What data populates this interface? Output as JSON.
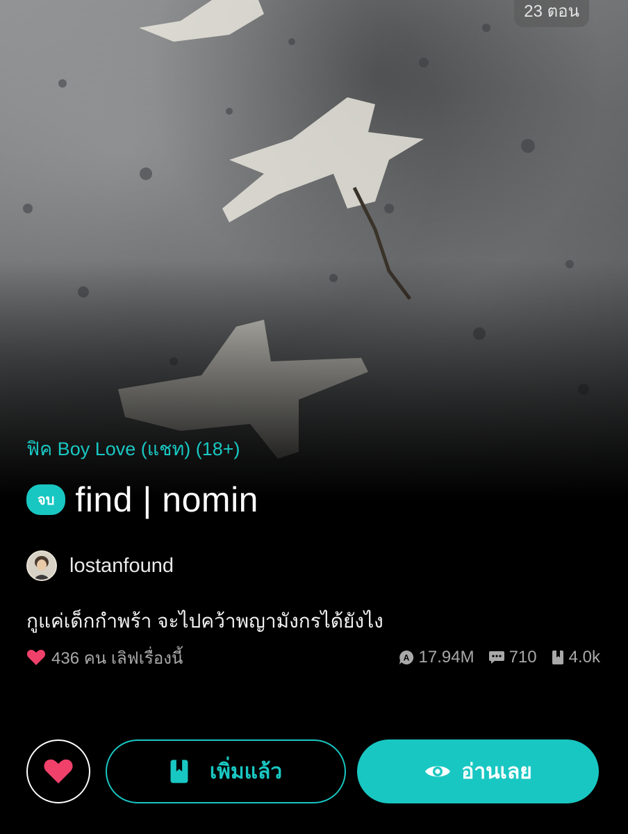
{
  "cover": {
    "episode_count": "23 ตอน"
  },
  "story": {
    "category": "ฟิค Boy Love (แชท) (18+)",
    "status_badge": "จบ",
    "title": "find | nomin",
    "author": "lostanfound",
    "synopsis": "กูแค่เด็กกำพร้า จะไปคว้าพญามังกรได้ยังไง"
  },
  "stats": {
    "love_text": "436 คน เลิฟเรื่องนี้",
    "views": "17.94M",
    "comments": "710",
    "bookmarks": "4.0k"
  },
  "actions": {
    "library_label": "เพิ่มแล้ว",
    "read_label": "อ่านเลย"
  },
  "icons": {
    "heart": "heart-icon",
    "views": "views-icon",
    "comments": "comment-icon",
    "bookmarks": "book-icon",
    "library": "bookmark-icon",
    "read": "eye-icon"
  },
  "colors": {
    "accent": "#19c7c2",
    "heart": "#f0416b",
    "background": "#000000",
    "muted_text": "#a9a9a9"
  }
}
